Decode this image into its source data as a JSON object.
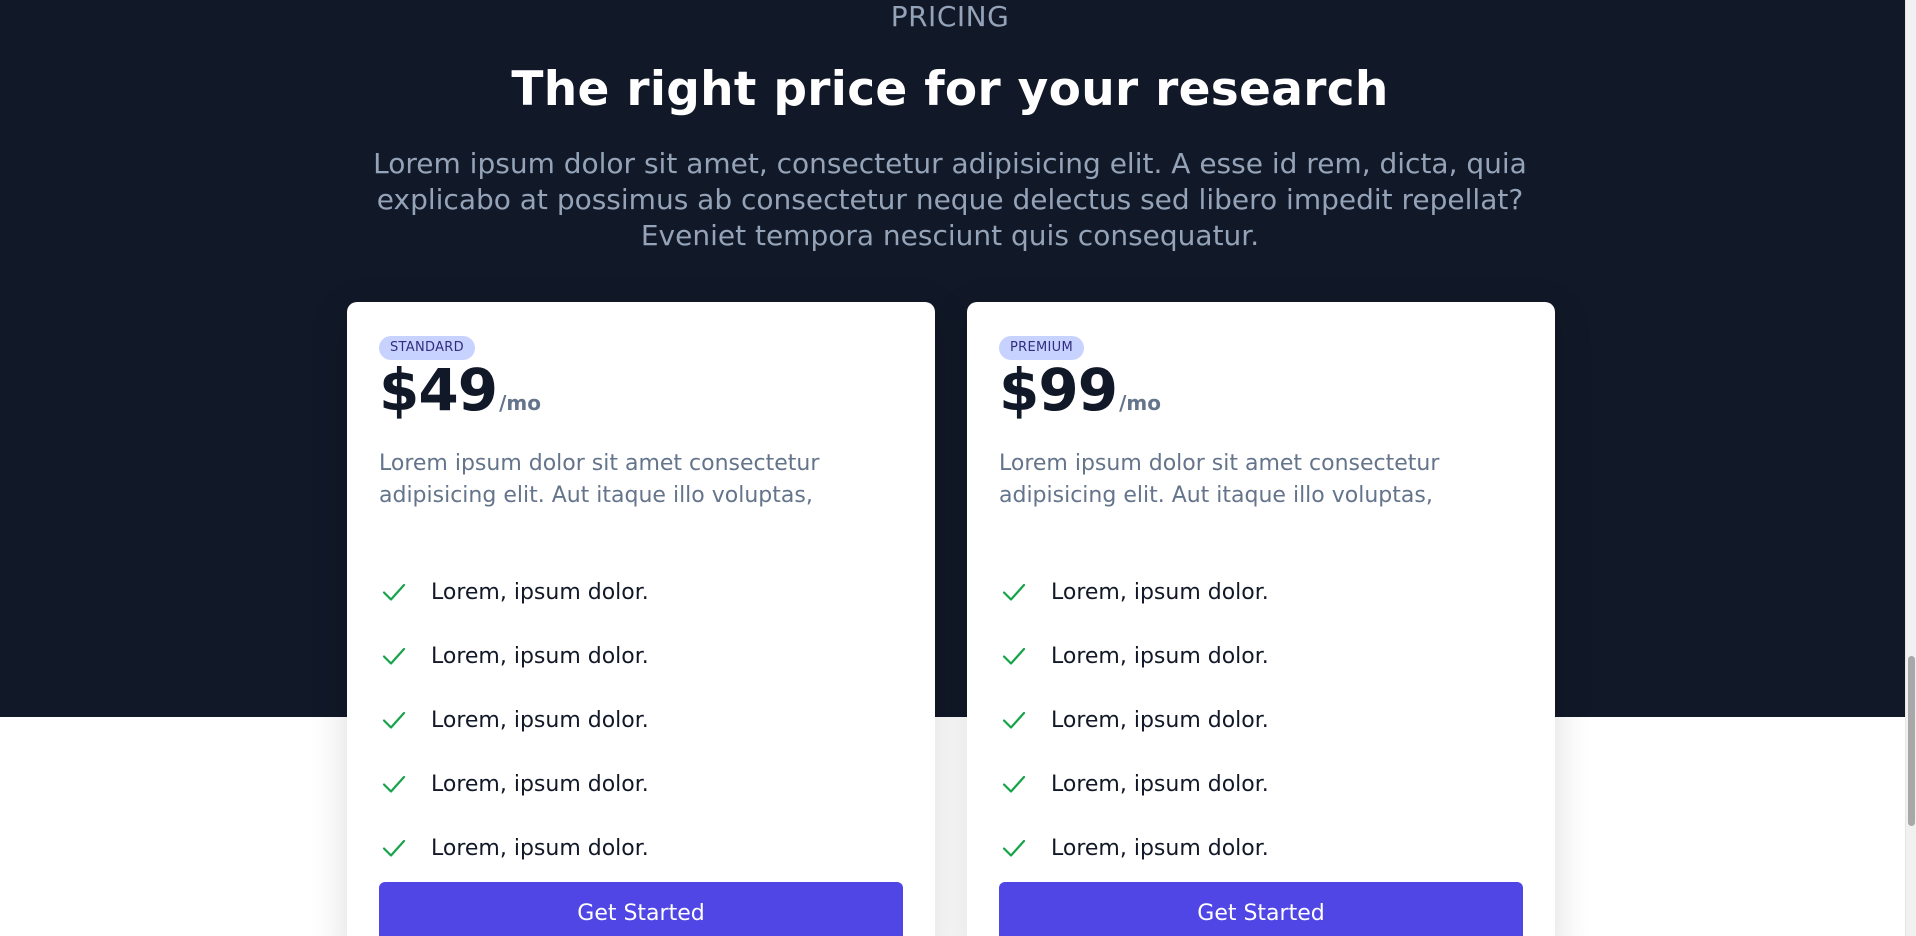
{
  "section": {
    "eyebrow": "PRICING",
    "headline": "The right price for your research",
    "lead": "Lorem ipsum dolor sit amet, consectetur adipisicing elit. A esse id rem, dicta, quia explicabo at possimus ab consectetur neque delectus sed libero impedit repellat? Eveniet tempora nesciunt quis consequatur."
  },
  "colors": {
    "dark_bg": "#111827",
    "accent": "#4f46e5",
    "badge_bg": "#c7d2fe",
    "check": "#16a34a"
  },
  "plans": [
    {
      "badge": "STANDARD",
      "price": "$49",
      "period": "/mo",
      "description": "Lorem ipsum dolor sit amet consectetur adipisicing elit. Aut itaque illo voluptas,",
      "features": [
        "Lorem, ipsum dolor.",
        "Lorem, ipsum dolor.",
        "Lorem, ipsum dolor.",
        "Lorem, ipsum dolor.",
        "Lorem, ipsum dolor."
      ],
      "feature_icon": "check-icon",
      "cta": "Get Started"
    },
    {
      "badge": "PREMIUM",
      "price": "$99",
      "period": "/mo",
      "description": "Lorem ipsum dolor sit amet consectetur adipisicing elit. Aut itaque illo voluptas,",
      "features": [
        "Lorem, ipsum dolor.",
        "Lorem, ipsum dolor.",
        "Lorem, ipsum dolor.",
        "Lorem, ipsum dolor.",
        "Lorem, ipsum dolor."
      ],
      "feature_icon": "check-icon",
      "cta": "Get Started"
    }
  ]
}
